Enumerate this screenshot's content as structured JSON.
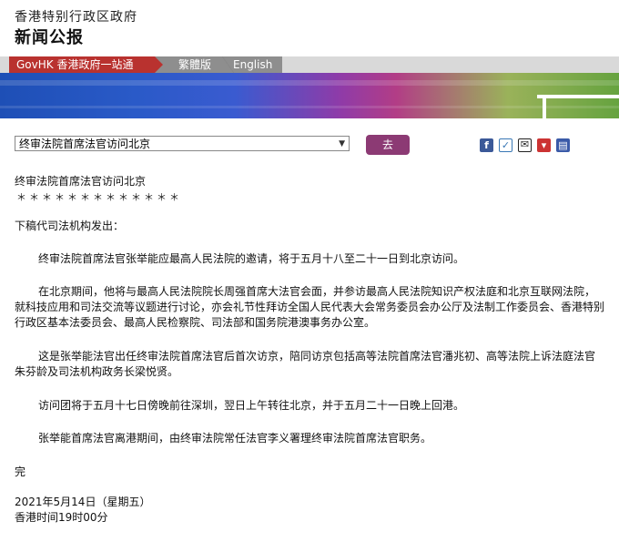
{
  "header": {
    "gov_title": "香港特别行政区政府",
    "press_title": "新闻公报"
  },
  "nav": {
    "govhk": "GovHK 香港政府一站通",
    "traditional": "繁體版",
    "english": "English"
  },
  "selector": {
    "selected": "终审法院首席法官访问北京",
    "go_label": "去"
  },
  "share_icons": [
    "facebook-icon",
    "twitter-icon",
    "email-icon",
    "bookmark-icon",
    "print-icon"
  ],
  "article": {
    "title": "终审法院首席法官访问北京",
    "stars": "＊＊＊＊＊＊＊＊＊＊＊＊＊",
    "intro": "下稿代司法机构发出：",
    "paragraphs": [
      "终审法院首席法官张举能应最高人民法院的邀请，将于五月十八至二十一日到北京访问。",
      "在北京期间，他将与最高人民法院院长周强首席大法官会面，并参访最高人民法院知识产权法庭和北京互联网法院，就科技应用和司法交流等议题进行讨论，亦会礼节性拜访全国人民代表大会常务委员会办公厅及法制工作委员会、香港特别行政区基本法委员会、最高人民检察院、司法部和国务院港澳事务办公室。",
      "这是张举能法官出任终审法院首席法官后首次访京，陪同访京包括高等法院首席法官潘兆初、高等法院上诉法庭法官朱芬龄及司法机构政务长梁悦贤。",
      "访问团将于五月十七日傍晚前往深圳，翌日上午转往北京，并于五月二十一日晚上回港。",
      "张举能首席法官离港期间，由终审法院常任法官李义署理终审法院首席法官职务。"
    ],
    "end": "完",
    "date": "2021年5月14日（星期五）",
    "time": "香港时间19时00分"
  }
}
